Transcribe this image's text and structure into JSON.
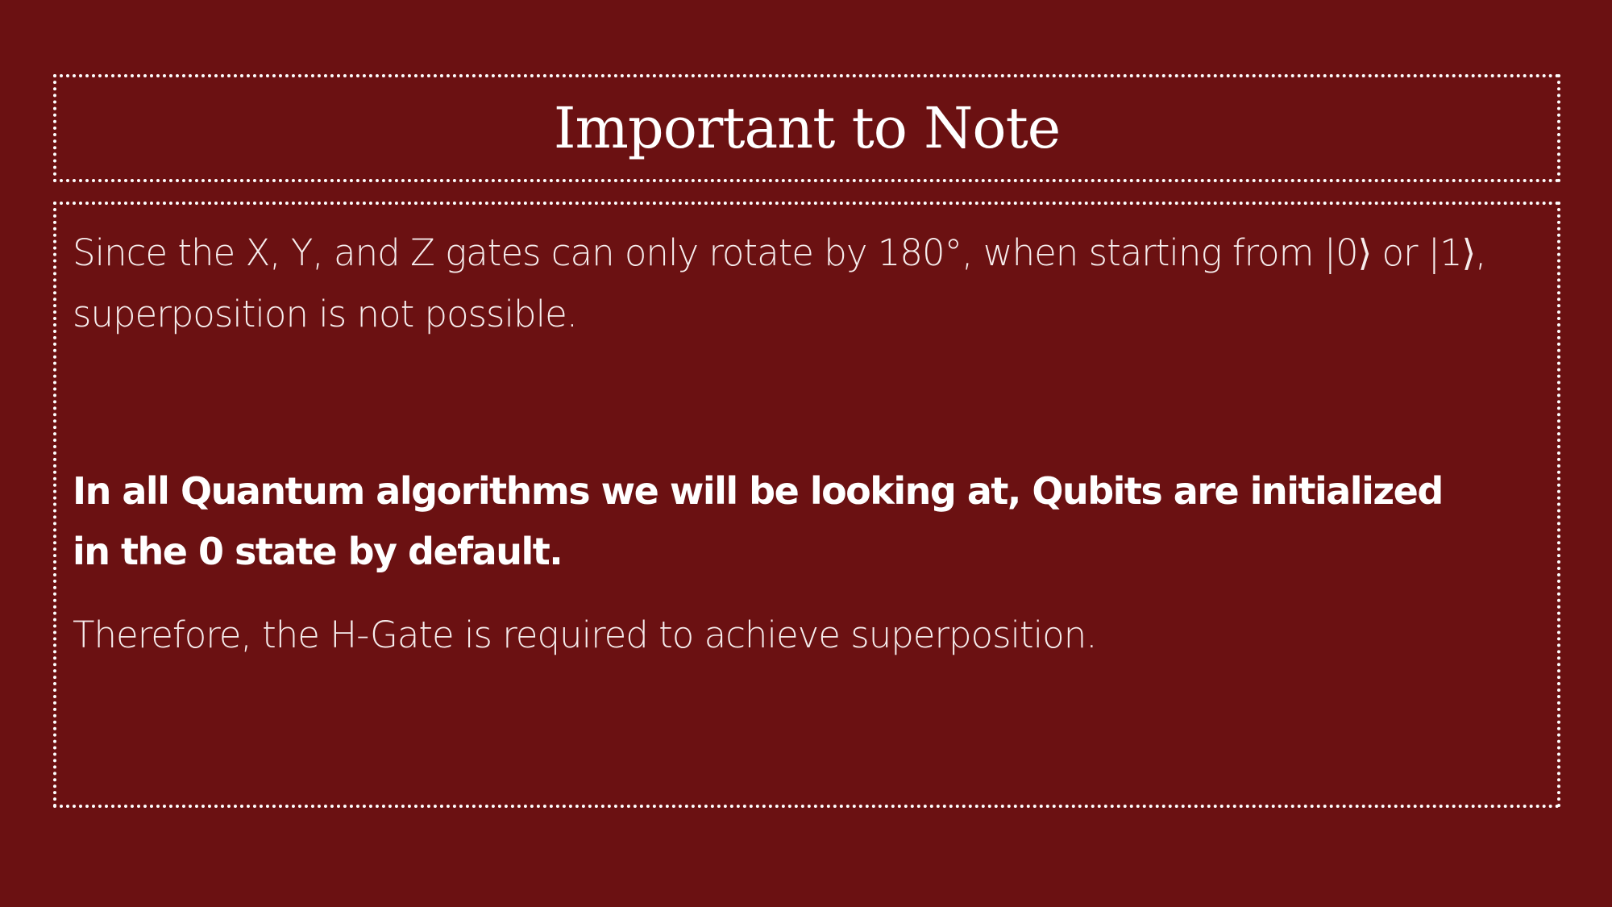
{
  "slide": {
    "title": "Important to Note",
    "paragraphs": {
      "p1": "Since the X, Y, and Z gates can only rotate by 180°, when starting from |0⟩ or |1⟩, superposition is not possible.",
      "p2": "In all Quantum algorithms we will be looking at, Qubits are initialized in the 0 state by default.",
      "p3": "Therefore, the H-Gate is required to achieve superposition."
    }
  },
  "colors": {
    "background": "#6b1112",
    "text": "#ffffff",
    "border": "#ffffff"
  }
}
